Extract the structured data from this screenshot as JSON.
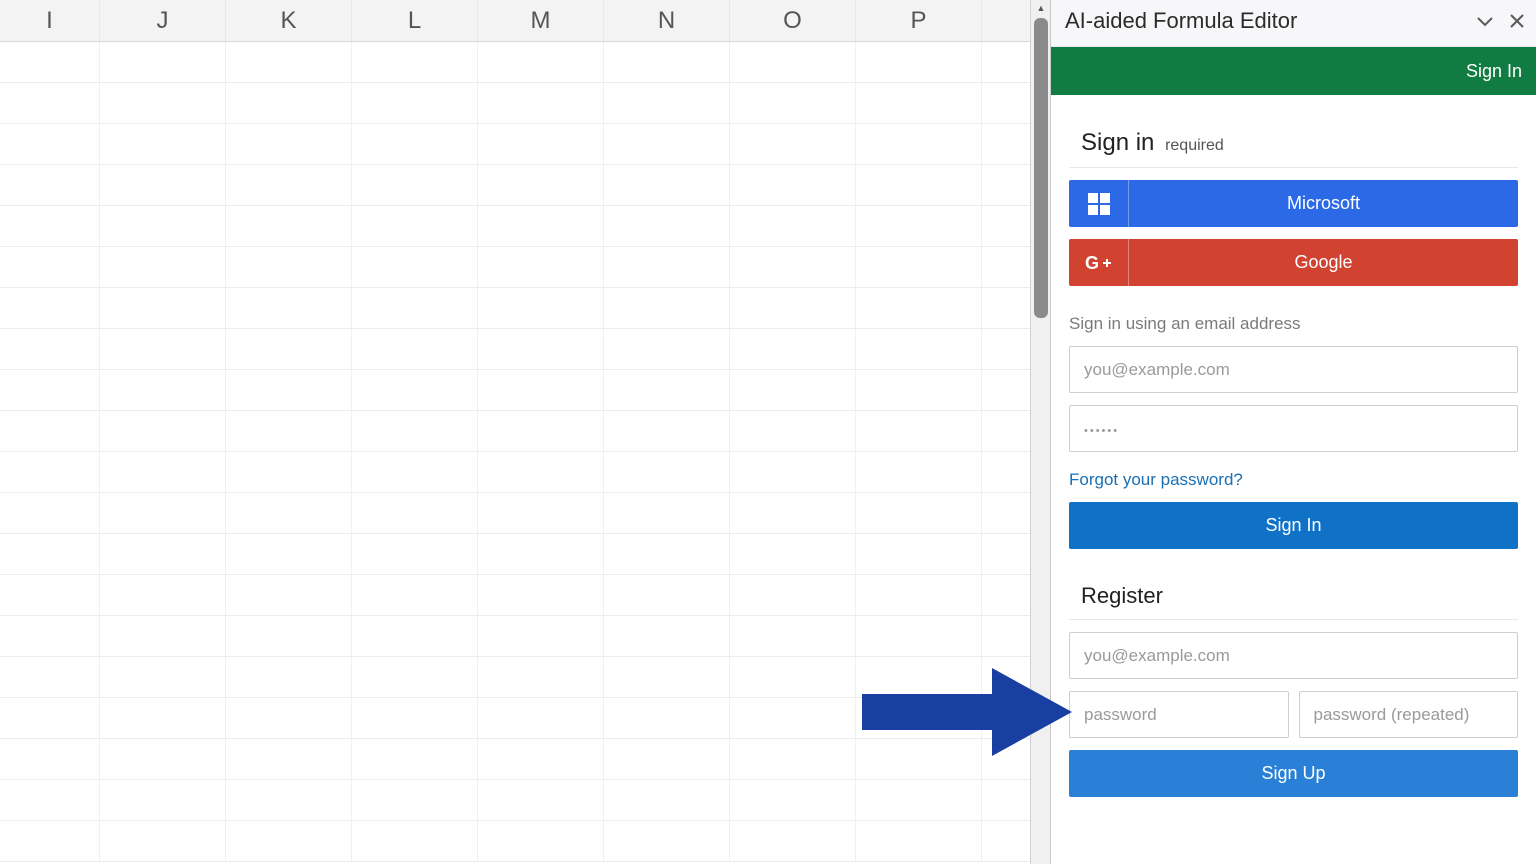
{
  "columns": [
    "I",
    "J",
    "K",
    "L",
    "M",
    "N",
    "O",
    "P"
  ],
  "pane": {
    "title": "AI-aided Formula Editor",
    "tab_label": "Sign In",
    "signin": {
      "heading": "Sign in",
      "heading_sub": "required",
      "ms_label": "Microsoft",
      "g_label": "Google",
      "hint": "Sign in using an email address",
      "email_placeholder": "you@example.com",
      "pwd_placeholder": "••••••",
      "forgot": "Forgot your password?",
      "submit": "Sign In"
    },
    "register": {
      "heading": "Register",
      "email_placeholder": "you@example.com",
      "pwd_placeholder": "password",
      "pwd2_placeholder": "password (repeated)",
      "submit": "Sign Up"
    }
  }
}
